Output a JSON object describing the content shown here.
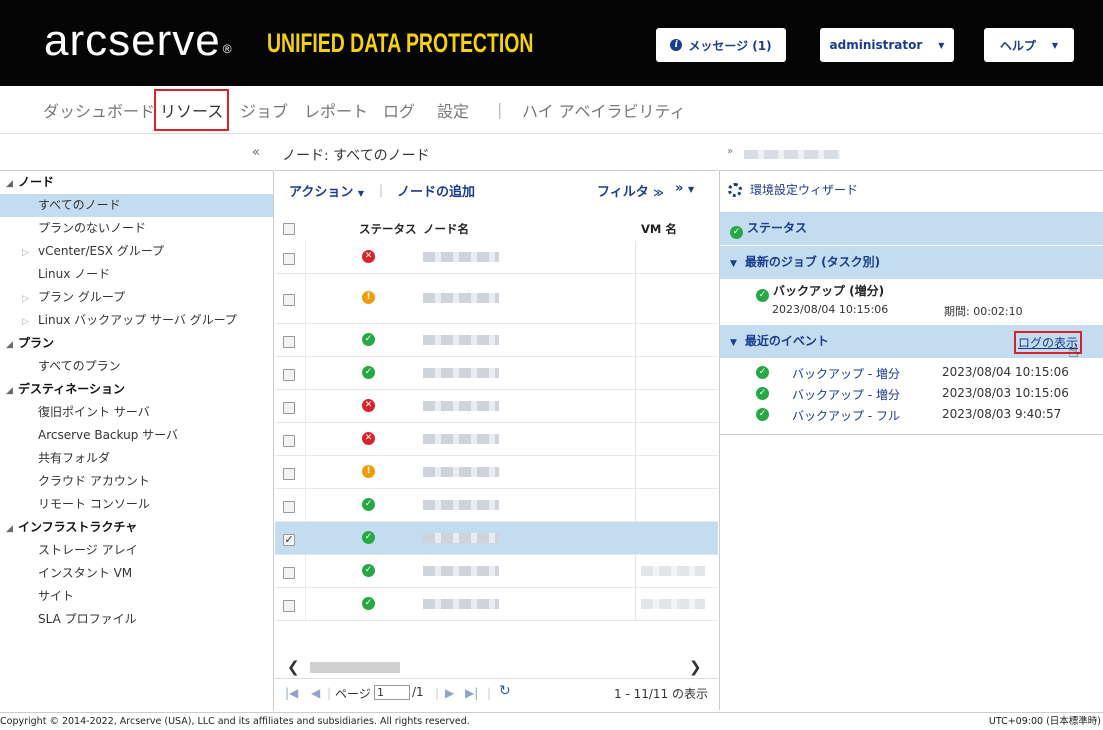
{
  "header": {
    "logo": "arcserve",
    "logo_mark": "®",
    "product": "UNIFIED DATA PROTECTION",
    "messages_label": "メッセージ (1)",
    "user_label": "administrator",
    "help_label": "ヘルプ"
  },
  "nav": {
    "items": [
      "ダッシュボード",
      "リソース",
      "ジョブ",
      "レポート",
      "ログ",
      "設定",
      "|",
      "ハイ アベイラビリティ"
    ],
    "active": "リソース"
  },
  "title": {
    "collapse": "«",
    "page_title": "ノード: すべてのノード",
    "expand": "»"
  },
  "tree": {
    "nodes_header": "ノード",
    "all_nodes": "すべてのノード",
    "nodes_without_plan": "プランのないノード",
    "vcenter_group": "vCenter/ESX グループ",
    "linux_nodes": "Linux ノード",
    "plan_group": "プラン グループ",
    "linux_backup_server_group": "Linux バックアップ サーバ グループ",
    "plans_header": "プラン",
    "all_plans": "すべてのプラン",
    "destinations_header": "デスティネーション",
    "recovery_point_server": "復旧ポイント サーバ",
    "arcserve_backup_server": "Arcserve Backup サーバ",
    "shared_folder": "共有フォルダ",
    "cloud_account": "クラウド アカウント",
    "remote_console": "リモート コンソール",
    "infrastructure_header": "インフラストラクチャ",
    "storage_array": "ストレージ アレイ",
    "instant_vm": "インスタント VM",
    "sites": "サイト",
    "sla_profile": "SLA プロファイル"
  },
  "toolbar": {
    "actions": "アクション",
    "add_node": "ノードの追加",
    "filter": "フィルタ",
    "more": "»"
  },
  "grid": {
    "columns": {
      "status": "ステータス",
      "node_name": "ノード名",
      "vm_name": "VM 名"
    },
    "rows": [
      {
        "status": "error",
        "checked": false
      },
      {
        "status": "warning",
        "checked": false
      },
      {
        "status": "ok",
        "checked": false
      },
      {
        "status": "ok",
        "checked": false
      },
      {
        "status": "error",
        "checked": false
      },
      {
        "status": "error",
        "checked": false
      },
      {
        "status": "warning",
        "checked": false
      },
      {
        "status": "ok",
        "checked": false
      },
      {
        "status": "ok",
        "checked": true
      },
      {
        "status": "ok",
        "checked": false
      },
      {
        "status": "ok",
        "checked": false
      }
    ]
  },
  "pager": {
    "page_label": "ページ",
    "page_value": "1",
    "page_total": "/1",
    "summary": "1 - 11/11 の表示"
  },
  "right": {
    "wizard": "環境設定ウィザード",
    "status_header": "ステータス",
    "latest_job_header": "最新のジョブ (タスク別)",
    "job_title": "バックアップ (増分)",
    "job_date": "2023/08/04 10:15:06",
    "job_duration": "期間: 00:02:10",
    "recent_events_header": "最近のイベント",
    "view_logs": "ログの表示",
    "events": [
      {
        "name": "バックアップ - 増分",
        "date": "2023/08/04 10:15:06"
      },
      {
        "name": "バックアップ - 増分",
        "date": "2023/08/03 10:15:06"
      },
      {
        "name": "バックアップ - フル",
        "date": "2023/08/03 9:40:57"
      }
    ]
  },
  "footer": {
    "copyright": "Copyright © 2014-2022, Arcserve (USA), LLC and its affiliates and subsidiaries. All rights reserved.",
    "timezone": "UTC+09:00 (日本標準時)"
  },
  "colors": {
    "header_bg": "#050505",
    "product_yellow": "#f5d210",
    "link_blue": "#1a3b8f",
    "selection_blue": "#c3dcef",
    "highlight_red": "#d8232a",
    "status_ok": "#27a844",
    "status_error": "#d8232a",
    "status_warning": "#f09b0c"
  }
}
